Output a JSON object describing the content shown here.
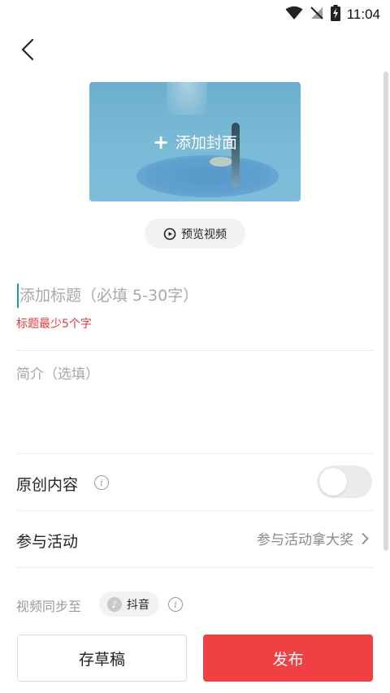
{
  "status_bar": {
    "time": "11:04"
  },
  "cover": {
    "label": "添加封面"
  },
  "preview": {
    "label": "预览视频"
  },
  "title": {
    "placeholder": "添加标题（必填 5-30字）",
    "error": "标题最少5个字"
  },
  "intro": {
    "placeholder": "简介（选填）"
  },
  "original": {
    "label": "原创内容",
    "enabled": false
  },
  "activity": {
    "label": "参与活动",
    "value": "参与活动拿大奖"
  },
  "sync": {
    "label": "视频同步至",
    "platform": "抖音"
  },
  "actions": {
    "draft": "存草稿",
    "publish": "发布"
  },
  "colors": {
    "accent": "#ef4044",
    "error": "#e4393c",
    "caret": "#16a393"
  }
}
